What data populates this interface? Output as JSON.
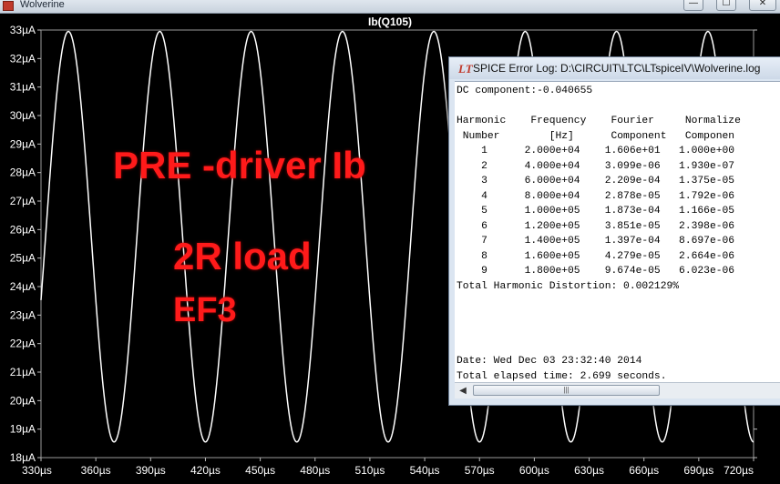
{
  "window": {
    "title": "Wolverine",
    "controls": {
      "minimize": "—",
      "maximize": "☐",
      "close": "✕"
    }
  },
  "chart_data": {
    "type": "line",
    "title": "Ib(Q105)",
    "xlabel": "",
    "ylabel": "",
    "xlim": [
      330,
      720
    ],
    "ylim": [
      18,
      33
    ],
    "x_unit": "µs",
    "y_unit": "µA",
    "xticks": [
      "330µs",
      "360µs",
      "390µs",
      "420µs",
      "450µs",
      "480µs",
      "510µs",
      "540µs",
      "570µs",
      "600µs",
      "630µs",
      "660µs",
      "690µs",
      "720µs"
    ],
    "yticks": [
      "18µA",
      "19µA",
      "20µA",
      "21µA",
      "22µA",
      "23µA",
      "24µA",
      "25µA",
      "26µA",
      "27µA",
      "28µA",
      "29µA",
      "30µA",
      "31µA",
      "32µA",
      "33µA"
    ],
    "grid": false,
    "background": "#000000",
    "trace_color": "#ffffff",
    "series": [
      {
        "name": "Ib(Q105)",
        "waveform": "sine",
        "frequency_hz": 20000,
        "min": 18.55,
        "max": 32.95,
        "first_peak_x": 345
      }
    ]
  },
  "overlay": {
    "line1": "PRE -driver Ib",
    "line2": "2R load",
    "line3": "EF3",
    "color": "#ff1a1a"
  },
  "error_log": {
    "icon": "LT",
    "title": "SPICE Error Log: D:\\CIRCUIT\\LTC\\LTspiceIV\\Wolverine.log",
    "lines": [
      "DC component:-0.040655",
      "",
      "Harmonic    Frequency    Fourier     Normalize",
      " Number        [Hz]      Component   Componen",
      "    1      2.000e+04    1.606e+01   1.000e+00",
      "    2      4.000e+04    3.099e-06   1.930e-07",
      "    3      6.000e+04    2.209e-04   1.375e-05",
      "    4      8.000e+04    2.878e-05   1.792e-06",
      "    5      1.000e+05    1.873e-04   1.166e-05",
      "    6      1.200e+05    3.851e-05   2.398e-06",
      "    7      1.400e+05    1.397e-04   8.697e-06",
      "    8      1.600e+05    4.279e-05   2.664e-06",
      "    9      1.800e+05    9.674e-05   6.023e-06",
      "Total Harmonic Distortion: 0.002129%",
      "",
      "",
      "",
      "",
      "Date: Wed Dec 03 23:32:40 2014",
      "Total elapsed time: 2.699 seconds."
    ],
    "scroll_left_icon": "◀",
    "scroll_thumb_grip": "|||"
  }
}
